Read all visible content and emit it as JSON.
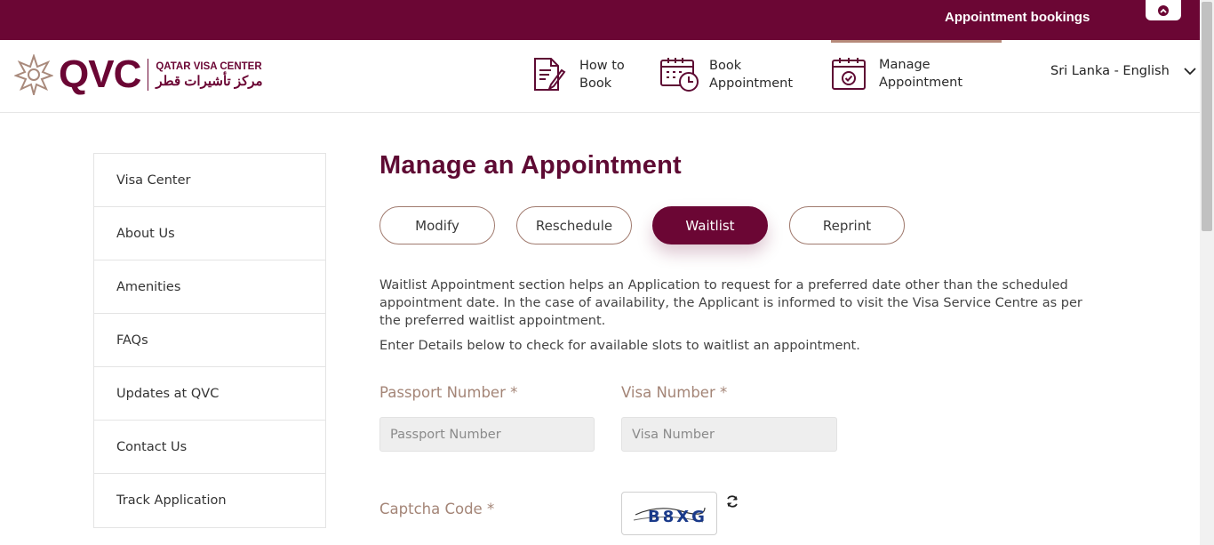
{
  "topbar": {
    "appointment_bookings": "Appointment bookings"
  },
  "logo": {
    "brand": "QVC",
    "name_en": "QATAR VISA CENTER",
    "name_ar": "مركز تأشيرات قطر"
  },
  "nav": [
    {
      "label1": "How to",
      "label2": "Book",
      "icon": "document-pen-icon"
    },
    {
      "label1": "Book",
      "label2": "Appointment",
      "icon": "calendar-clock-icon"
    },
    {
      "label1": "Manage",
      "label2": "Appointment",
      "icon": "calendar-check-icon"
    }
  ],
  "language": {
    "selected": "Sri Lanka - English"
  },
  "sidebar": {
    "items": [
      {
        "label": "Visa Center"
      },
      {
        "label": "About Us"
      },
      {
        "label": "Amenities"
      },
      {
        "label": "FAQs"
      },
      {
        "label": "Updates at QVC"
      },
      {
        "label": "Contact Us"
      },
      {
        "label": "Track Application"
      }
    ]
  },
  "main": {
    "title": "Manage an Appointment",
    "tabs": [
      {
        "label": "Modify"
      },
      {
        "label": "Reschedule"
      },
      {
        "label": "Waitlist"
      },
      {
        "label": "Reprint"
      }
    ],
    "description": "Waitlist Appointment section helps an Application to request for a preferred date other than the scheduled appointment date. In the case of availability, the Applicant is informed to visit the Visa Service Centre as per the preferred waitlist appointment.",
    "instruction": "Enter Details below to check for available slots to waitlist an appointment.",
    "form": {
      "passport_label": "Passport Number *",
      "passport_placeholder": "Passport Number",
      "passport_value": "",
      "visa_label": "Visa Number *",
      "visa_placeholder": "Visa Number",
      "visa_value": "",
      "captcha_label": "Captcha Code *",
      "captcha_text": "B8XG"
    }
  },
  "colors": {
    "brand": "#6b0634",
    "label": "#a48577",
    "tab_border": "#a07a6e"
  }
}
